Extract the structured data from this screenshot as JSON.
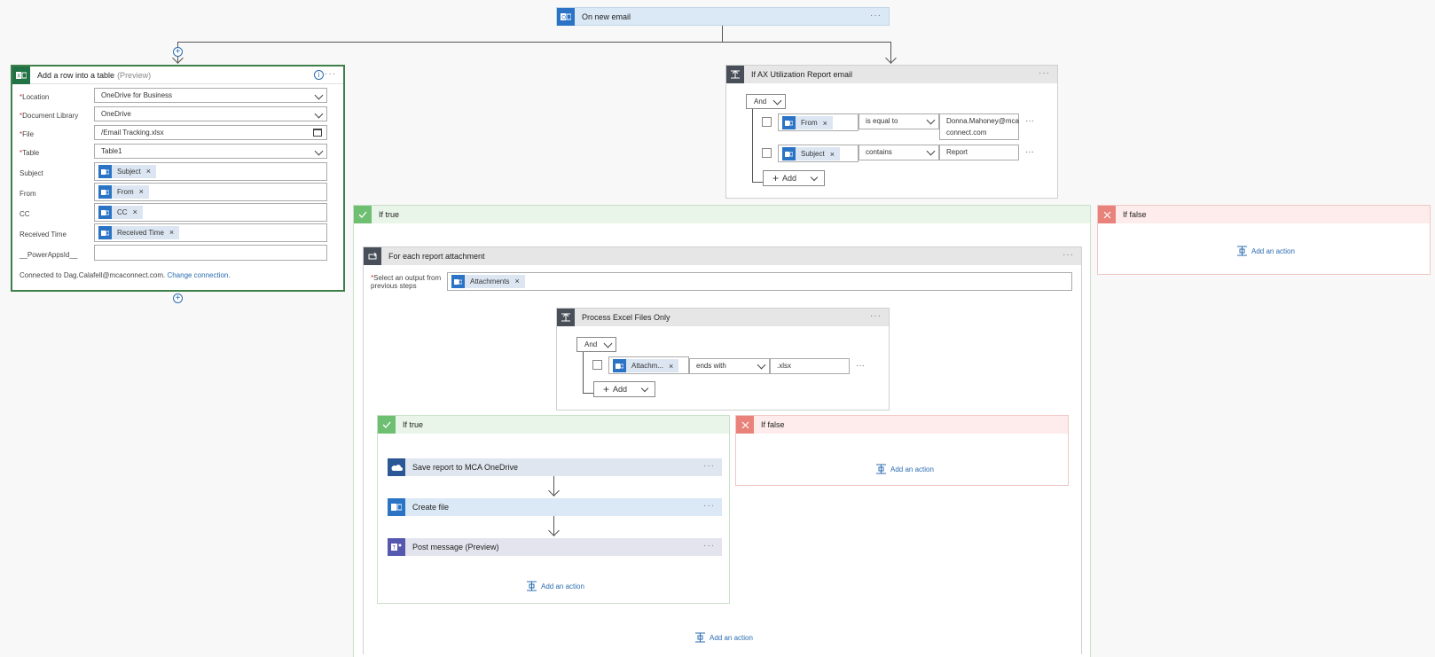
{
  "trigger": {
    "title": "On new email",
    "menu": "···"
  },
  "excel_card": {
    "title": "Add a row into a table",
    "preview": "(Preview)",
    "menu": "···",
    "fields": [
      {
        "label": "Location",
        "required": true,
        "value": "OneDrive for Business",
        "kind": "dropdown"
      },
      {
        "label": "Document Library",
        "required": true,
        "value": "OneDrive",
        "kind": "dropdown"
      },
      {
        "label": "File",
        "required": true,
        "value": "/Email Tracking.xlsx",
        "kind": "file"
      },
      {
        "label": "Table",
        "required": true,
        "value": "Table1",
        "kind": "dropdown"
      },
      {
        "label": "Subject",
        "required": false,
        "token": "Subject",
        "kind": "token"
      },
      {
        "label": "From",
        "required": false,
        "token": "From",
        "kind": "token"
      },
      {
        "label": "CC",
        "required": false,
        "token": "CC",
        "kind": "token"
      },
      {
        "label": "Received Time",
        "required": false,
        "token": "Received Time",
        "kind": "token"
      },
      {
        "label": "__PowerAppsId__",
        "required": false,
        "value": "",
        "kind": "text"
      }
    ],
    "connected_text": "Connected to Dag.Calafell@mcaconnect.com.",
    "change_connection": "Change connection."
  },
  "condition_card": {
    "title": "If AX Utilization Report email",
    "menu": "···",
    "and_label": "And",
    "rows": [
      {
        "token": "From",
        "operator": "is equal to",
        "value_line1": "Donna.Mahoney@mca",
        "value_line2": "connect.com"
      },
      {
        "token": "Subject",
        "operator": "contains",
        "value_line1": "Report",
        "value_line2": ""
      }
    ],
    "add_label": "Add",
    "row_menu": "···"
  },
  "if_true": {
    "label": "If true",
    "add_action": "Add an action"
  },
  "if_false": {
    "label": "If false",
    "add_action": "Add an action"
  },
  "foreach": {
    "title": "For each report attachment",
    "menu": "···",
    "select_label_line1": "Select an output from",
    "select_label_line2": "previous steps",
    "token": "Attachments"
  },
  "process_card": {
    "title": "Process Excel Files Only",
    "menu": "···",
    "and_label": "And",
    "row": {
      "token": "Attachm...",
      "operator": "ends with",
      "value": ".xlsx"
    },
    "add_label": "Add",
    "row_menu": "···"
  },
  "inner_true": {
    "label": "If true",
    "steps": [
      {
        "title": "Save report to MCA OneDrive",
        "preview": ""
      },
      {
        "title": "Create file",
        "preview": ""
      },
      {
        "title": "Post message",
        "preview": "(Preview)"
      }
    ],
    "step_menu": "···",
    "add_action": "Add an action"
  },
  "inner_false": {
    "label": "If false",
    "add_action": "Add an action"
  },
  "foreach_add_action": "Add an action",
  "colors": {
    "outlook_blue": "#2a73c5",
    "excel_green": "#217346",
    "condition_gray": "#484f58",
    "true_green": "#6fbf73",
    "false_red": "#e8827a",
    "teams_purple": "#5558af",
    "onedrive_blue": "#2b5797",
    "link_blue": "#2b6cb0"
  },
  "icons": [
    "outlook-icon",
    "excel-icon",
    "condition-icon",
    "foreach-icon",
    "check-icon",
    "close-icon",
    "onedrive-icon",
    "teams-icon",
    "add-action-icon",
    "plus-icon",
    "chevron-down-icon",
    "info-icon",
    "file-picker-icon"
  ]
}
